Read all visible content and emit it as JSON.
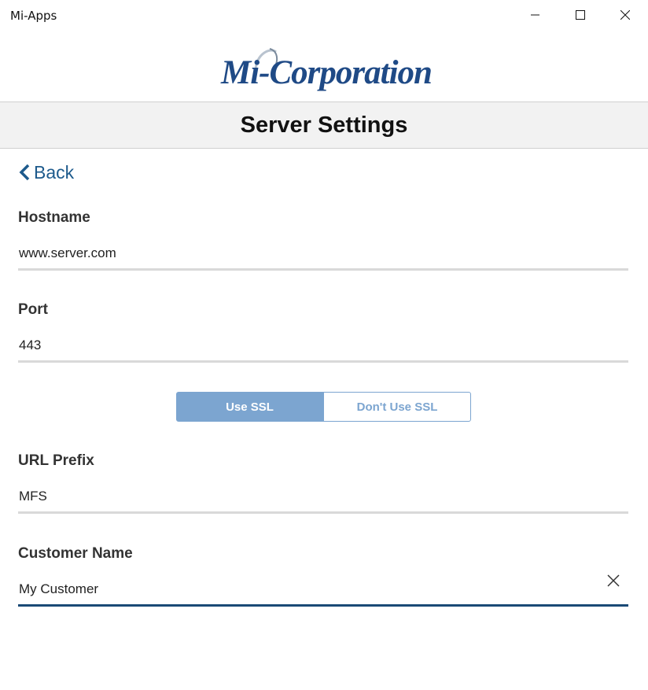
{
  "window": {
    "title": "Mi-Apps"
  },
  "logo": {
    "text": "Mi-Corporation"
  },
  "header": {
    "title": "Server Settings"
  },
  "nav": {
    "back_label": "Back"
  },
  "fields": {
    "hostname": {
      "label": "Hostname",
      "value": "www.server.com"
    },
    "port": {
      "label": "Port",
      "value": "443"
    },
    "url_prefix": {
      "label": "URL Prefix",
      "value": "MFS"
    },
    "customer_name": {
      "label": "Customer Name",
      "value": "My Customer"
    }
  },
  "ssl": {
    "on_label": "Use SSL",
    "off_label": "Don't Use SSL",
    "selected": "Use SSL"
  },
  "colors": {
    "accent": "#1d5a8c",
    "toggle_selected": "#7ca5d0",
    "active_underline": "#1a4a76",
    "logo_blue": "#1f4a86"
  }
}
